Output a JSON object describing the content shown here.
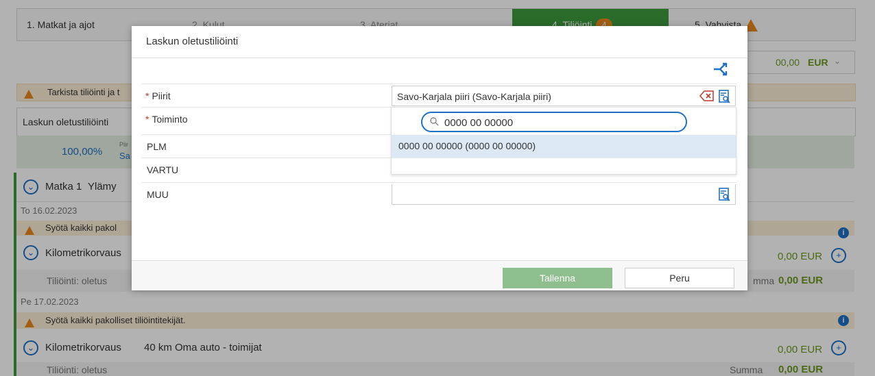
{
  "steps": [
    {
      "label": "1. Matkat ja ajot"
    },
    {
      "label": "2. Kulut"
    },
    {
      "label": "3. Ateriat"
    },
    {
      "label": "4. Tiliöinti",
      "badge": "4"
    },
    {
      "label": "5. Vahvista"
    }
  ],
  "background": {
    "total_amount": "00,00",
    "total_currency": "EUR",
    "warning_text": "Tarkista tiliöinti ja t",
    "default_posting_label": "Laskun oletustiliöinti",
    "percent": "100,00%",
    "percent_sub1": "Piir",
    "percent_sub2": "Sa",
    "trip_title": "Matka 1",
    "trip_sub": "Ylämy",
    "date1": "To 16.02.2023",
    "missing_warn_short": "Syötä kaikki pakol",
    "km_label_short": "Kilometrikorvaus",
    "amount1": "0,00 EUR",
    "posting1": "Tiliöinti: oletus",
    "sum1_label": "mma",
    "sum1_value": "0,00 EUR",
    "date2": "Pe 17.02.2023",
    "missing_warn": "Syötä kaikki pakolliset tiliöintitekijät.",
    "km_label": "Kilometrikorvaus",
    "km_detail": "40 km Oma auto - toimijat",
    "amount2": "0,00 EUR",
    "posting2": "Tiliöinti: oletus",
    "sum2_label": "Summa",
    "sum2_value": "0,00 EUR"
  },
  "modal": {
    "title": "Laskun oletustiliöinti",
    "fields": [
      {
        "label": "Piirit",
        "required": true,
        "value": "Savo-Karjala piiri (Savo-Karjala piiri)"
      },
      {
        "label": "Toiminto",
        "required": true,
        "value": ""
      },
      {
        "label": "PLM",
        "required": false,
        "value": ""
      },
      {
        "label": "VARTU",
        "required": false,
        "value": ""
      },
      {
        "label": "MUU",
        "required": false,
        "value": ""
      }
    ],
    "search_value": "0000 00 00000",
    "option": "0000 00 00000 (0000 00 00000)",
    "save_label": "Tallenna",
    "cancel_label": "Peru"
  },
  "icons": {
    "warning": "warning-triangle-icon",
    "lookup": "lookup-list-icon",
    "clear": "clear-icon",
    "shuffle": "shuffle-icon",
    "search": "search-icon",
    "expand": "chevron-circle-icon",
    "add": "plus-circle-icon",
    "info": "info-icon"
  },
  "colors": {
    "active_step": "#3d9a3d",
    "warning": "#e8891c",
    "primary": "#1f6fc4",
    "amount": "#6a9a1e",
    "error_border": "#aa3333"
  }
}
